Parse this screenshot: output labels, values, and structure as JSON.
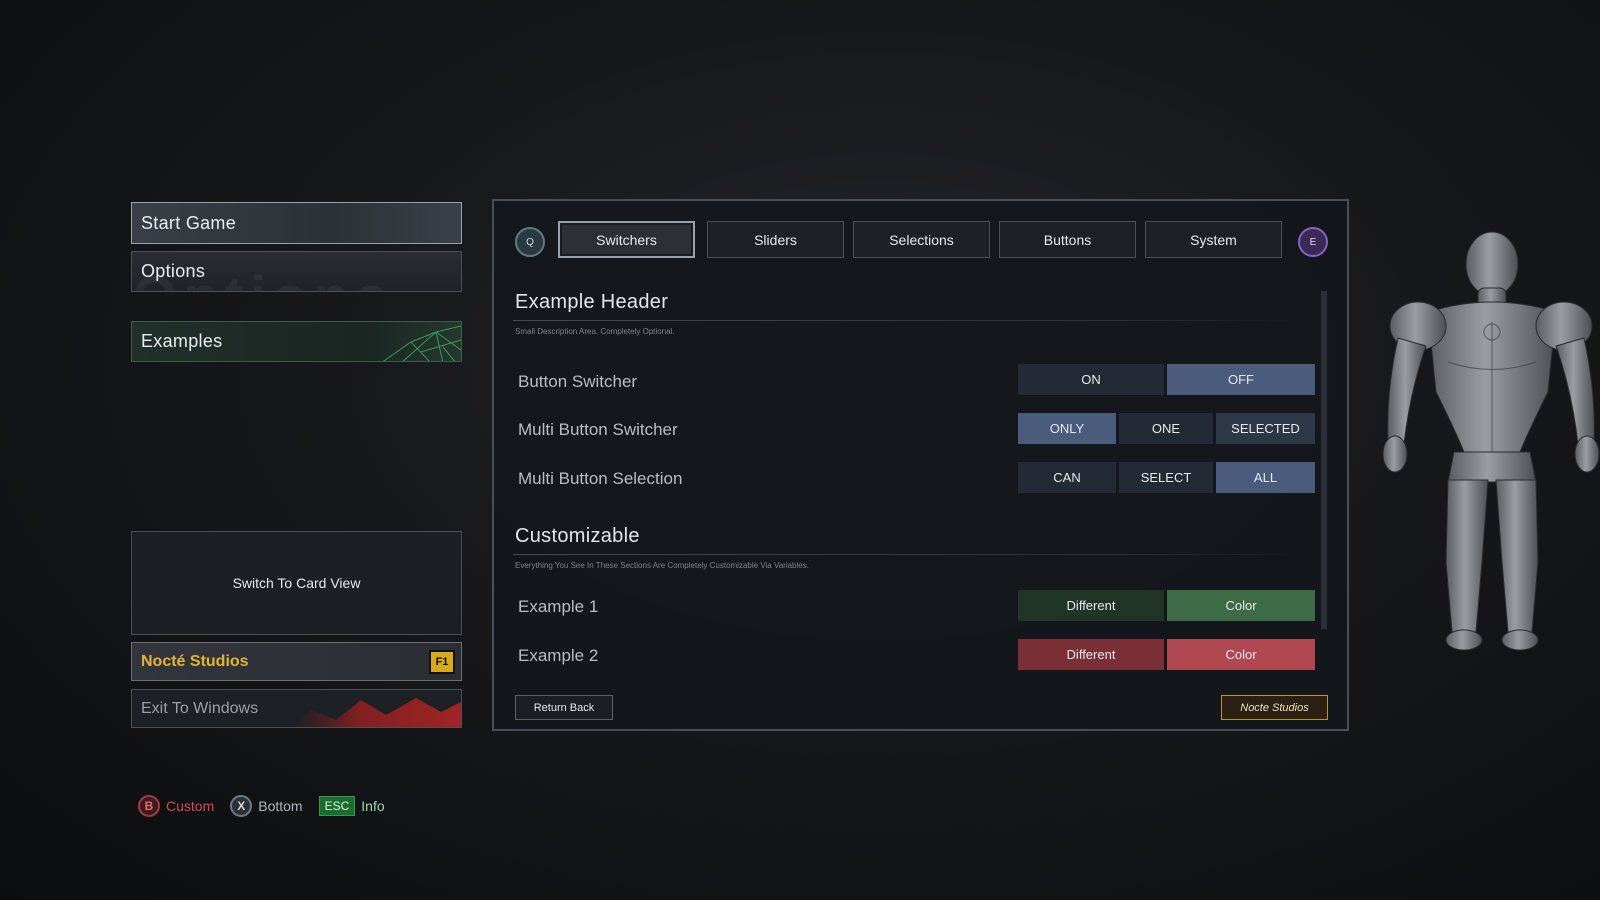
{
  "menu": {
    "start_game": "Start Game",
    "options": "Options",
    "options_ghost": "Options",
    "examples": "Examples",
    "switch_card_view": "Switch To Card View",
    "nocte_studios": "Nocté Studios",
    "nocte_key": "F1",
    "exit_windows": "Exit To Windows"
  },
  "hints": [
    {
      "key": "B",
      "label": "Custom"
    },
    {
      "key": "X",
      "label": "Bottom"
    },
    {
      "key": "ESC",
      "label": "Info"
    }
  ],
  "panel": {
    "prev_key": "Q",
    "next_key": "E",
    "tabs": [
      {
        "label": "Switchers",
        "active": true
      },
      {
        "label": "Sliders",
        "active": false
      },
      {
        "label": "Selections",
        "active": false
      },
      {
        "label": "Buttons",
        "active": false
      },
      {
        "label": "System",
        "active": false
      }
    ],
    "sections": [
      {
        "title": "Example Header",
        "description": "Small Description Area. Completely Optional.",
        "rows": [
          {
            "label": "Button Switcher",
            "options": [
              "ON",
              "OFF"
            ],
            "selected": "OFF"
          },
          {
            "label": "Multi Button Switcher",
            "options": [
              "ONLY",
              "ONE",
              "SELECTED"
            ],
            "selected": "ONLY"
          },
          {
            "label": "Multi Button Selection",
            "options": [
              "CAN",
              "SELECT",
              "ALL"
            ],
            "selected": "ALL"
          }
        ]
      },
      {
        "title": "Customizable",
        "description": "Everything You See In These Sections Are Completely Customizable Via Variables.",
        "rows": [
          {
            "label": "Example 1",
            "options": [
              "Different",
              "Color"
            ],
            "color": "#3f6a46"
          },
          {
            "label": "Example 2",
            "options": [
              "Different",
              "Color"
            ],
            "color": "#b04751"
          }
        ]
      }
    ],
    "return_back": "Return Back",
    "nocte_button": "Nocte Studios"
  },
  "colors": {
    "accent_gold": "#e4b431",
    "active_blue": "#4a5b7c",
    "green": "#3f6a46",
    "red": "#b04751"
  }
}
